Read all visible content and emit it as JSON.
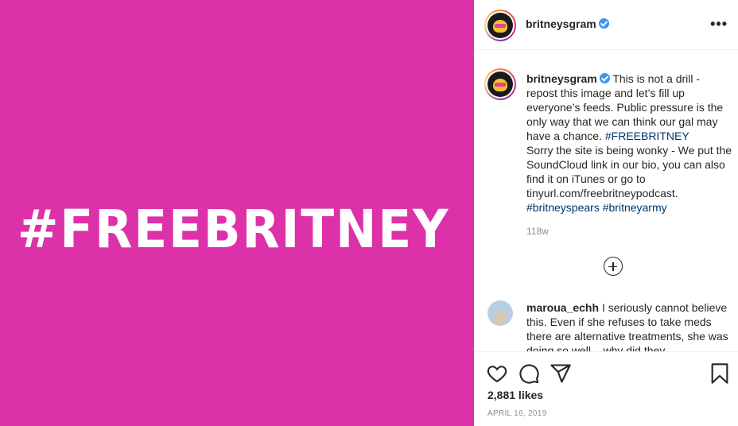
{
  "image": {
    "background_color": "#dd31a9",
    "text": "#FREEBRITNEY"
  },
  "header": {
    "username": "britneysgram",
    "more_icon": "more-options-icon",
    "more_glyph": "•••"
  },
  "caption": {
    "username": "britneysgram",
    "text_before_tag": "This is not a drill - repost this image and let’s fill up everyone’s feeds. Public pressure is the only way that we can think our gal may have a chance.",
    "hashtag_1": "#FREEBRITNEY",
    "text_after_tag": "Sorry the site is being wonky - We put the SoundCloud link in our bio, you can also find it on iTunes or go to tinyurl.com/freebritneypodcast.",
    "hashtag_2": "#britneyspears",
    "hashtag_3": "#britneyarmy",
    "time_ago": "118w"
  },
  "load_more_icon": "plus-circle-icon",
  "comment": {
    "username": "maroua_echh",
    "text": "I seriously cannot believe this. Even if she refuses to take meds there are alternative treatments, she was doing so well... why did they"
  },
  "actions": {
    "icons": [
      "heart-icon",
      "comment-bubble-icon",
      "paper-plane-icon",
      "bookmark-icon"
    ],
    "likes": "2,881 likes",
    "date": "APRIL 16, 2019"
  },
  "colors": {
    "accent_pink": "#dd31a9",
    "verified_blue": "#3897f0",
    "link_blue": "#00376b",
    "muted_gray": "#8e8e8e"
  }
}
